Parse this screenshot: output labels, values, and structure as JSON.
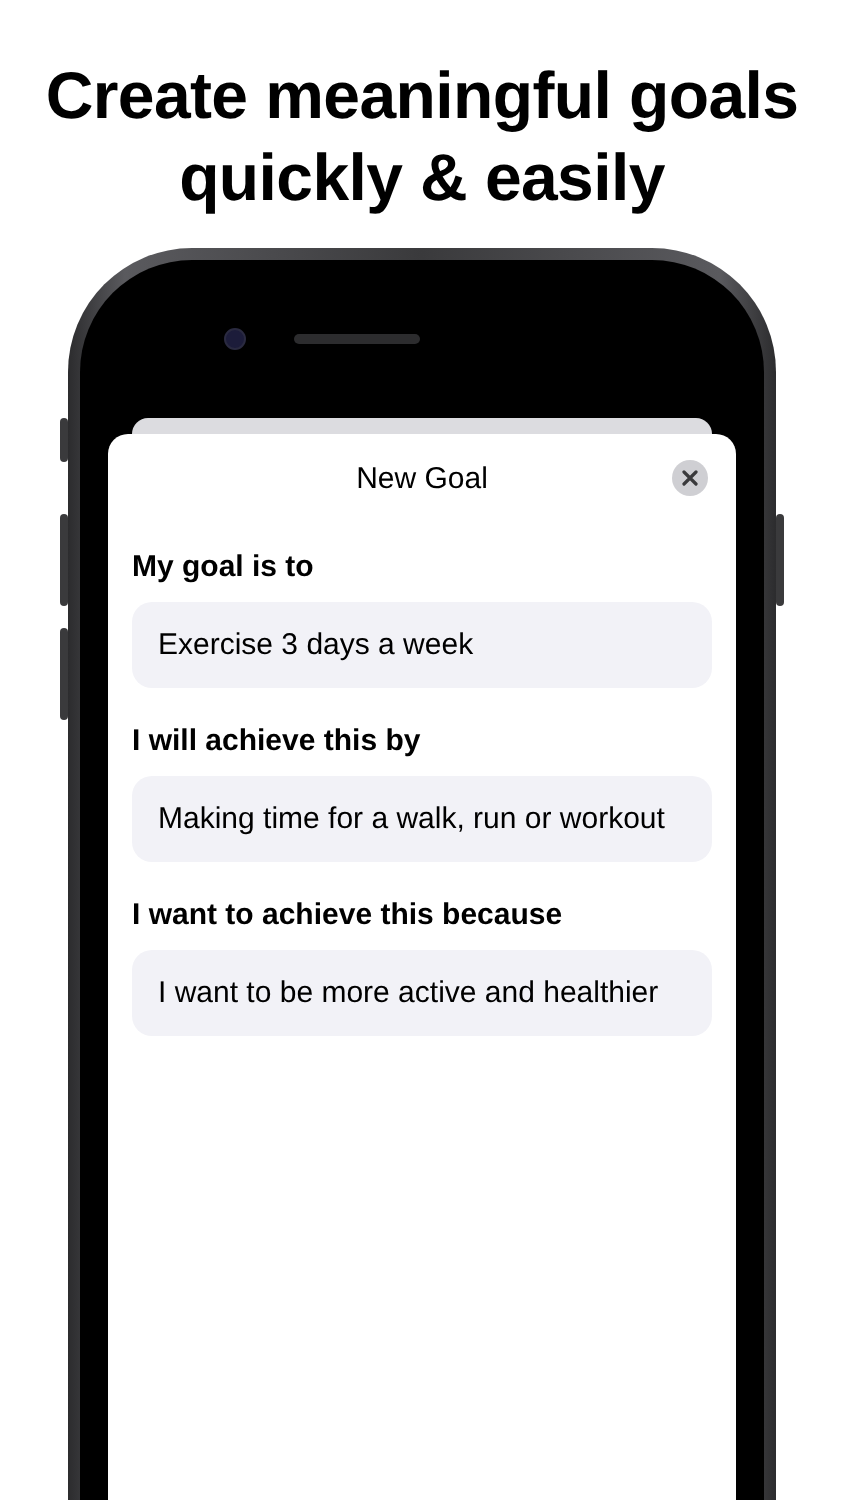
{
  "headline": [
    "Create meaningful goals",
    "quickly & easily"
  ],
  "sheet": {
    "title": "New Goal"
  },
  "fields": [
    {
      "label": "My goal is to",
      "value": "Exercise 3 days a week"
    },
    {
      "label": "I will achieve this by",
      "value": "Making time for a walk, run or workout"
    },
    {
      "label": "I want to achieve this because",
      "value": "I want to be more active and healthier"
    }
  ]
}
